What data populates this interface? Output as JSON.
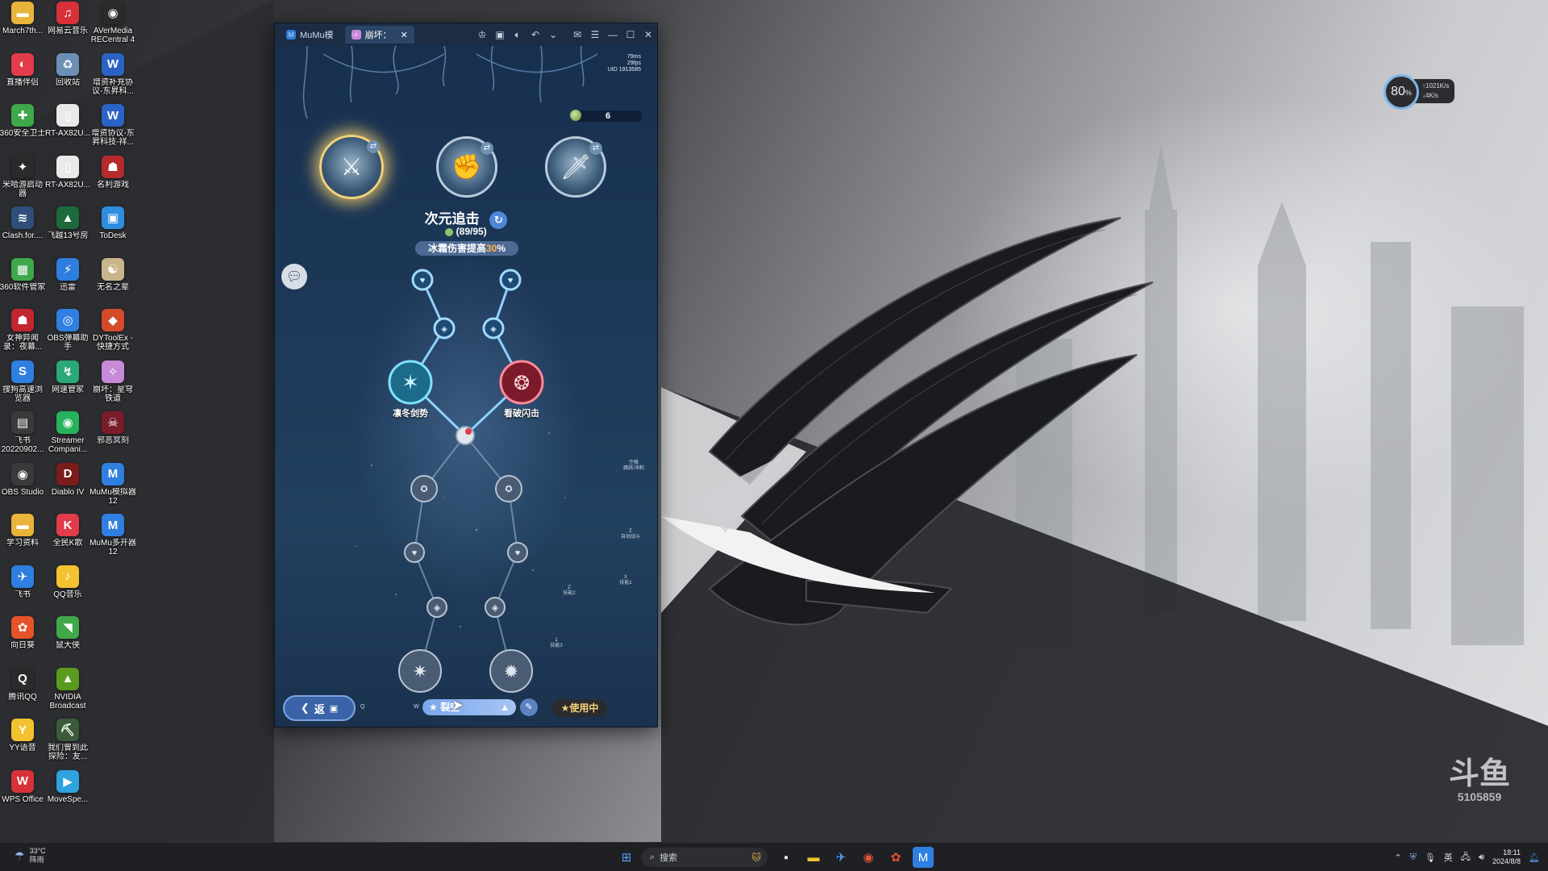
{
  "desktop": {
    "icons": [
      {
        "label": "March7th...",
        "color": "#e8b43a",
        "glyph": "▬"
      },
      {
        "label": "网易云音乐",
        "color": "#d8313a",
        "glyph": "♫"
      },
      {
        "label": "AVerMedia RECentral 4",
        "color": "#2a2a2a",
        "glyph": "◉"
      },
      {
        "label": "直播伴侣",
        "color": "#e23b4a",
        "glyph": "◐"
      },
      {
        "label": "回收站",
        "color": "#6c8fb5",
        "glyph": "♻"
      },
      {
        "label": "增资补充协议-东昇科...",
        "color": "#2b62c5",
        "glyph": "W"
      },
      {
        "label": "360安全卫士",
        "color": "#3fa84a",
        "glyph": "✚"
      },
      {
        "label": "RT-AX82U...",
        "color": "#e9e9e9",
        "glyph": "▯"
      },
      {
        "label": "增资协议-东昇科技-祥...",
        "color": "#2b62c5",
        "glyph": "W"
      },
      {
        "label": "米哈游启动器",
        "color": "#2a2a2a",
        "glyph": "✦"
      },
      {
        "label": "RT-AX82U...",
        "color": "#e9e9e9",
        "glyph": "▯"
      },
      {
        "label": "名利游戏",
        "color": "#b52b2b",
        "glyph": "☗"
      },
      {
        "label": "Clash.for....",
        "color": "#2f4f7a",
        "glyph": "≋"
      },
      {
        "label": "飞越13号房",
        "color": "#1d6a3a",
        "glyph": "▲"
      },
      {
        "label": "ToDesk",
        "color": "#2f8de0",
        "glyph": "▣"
      },
      {
        "label": "360软件管家",
        "color": "#3fa84a",
        "glyph": "▦"
      },
      {
        "label": "迅雷",
        "color": "#2e7ee0",
        "glyph": "⚡"
      },
      {
        "label": "无名之辈",
        "color": "#c9b58a",
        "glyph": "☯"
      },
      {
        "label": "女神异闻录：夜幕...",
        "color": "#c2262f",
        "glyph": "☗"
      },
      {
        "label": "OBS弹幕助手",
        "color": "#2f7fe0",
        "glyph": "◎"
      },
      {
        "label": "DYToolEx - 快捷方式",
        "color": "#d44b2a",
        "glyph": "◆"
      },
      {
        "label": "搜狗高速浏览器",
        "color": "#2f7fe0",
        "glyph": "S"
      },
      {
        "label": "网速管家",
        "color": "#2aa876",
        "glyph": "↯"
      },
      {
        "label": "崩坏：星穹铁道",
        "color": "#c88ad8",
        "glyph": "✧"
      },
      {
        "label": "飞书 20220902...",
        "color": "#3a3a3a",
        "glyph": "▤"
      },
      {
        "label": "Streamer Compani...",
        "color": "#27b35c",
        "glyph": "◉"
      },
      {
        "label": "邪恶冥刻",
        "color": "#7a1c2a",
        "glyph": "☠"
      },
      {
        "label": "OBS Studio",
        "color": "#3a3a3a",
        "glyph": "◉"
      },
      {
        "label": "Diablo IV",
        "color": "#7a1c1c",
        "glyph": "D"
      },
      {
        "label": "MuMu模拟器12",
        "color": "#2f7fe0",
        "glyph": "M"
      },
      {
        "label": "学习资料",
        "color": "#e8b43a",
        "glyph": "▬"
      },
      {
        "label": "全民K歌",
        "color": "#e23b4a",
        "glyph": "K"
      },
      {
        "label": "MuMu多开器12",
        "color": "#2f7fe0",
        "glyph": "M"
      },
      {
        "label": "飞书",
        "color": "#2f7fe0",
        "glyph": "✈"
      },
      {
        "label": "QQ音乐",
        "color": "#f2c230",
        "glyph": "♪"
      },
      {
        "label": "",
        "color": "",
        "glyph": ""
      },
      {
        "label": "向日葵",
        "color": "#e5532a",
        "glyph": "✿"
      },
      {
        "label": "鼠大侠",
        "color": "#3fa84a",
        "glyph": "◥"
      },
      {
        "label": "",
        "color": "",
        "glyph": ""
      },
      {
        "label": "腾讯QQ",
        "color": "#2a2a2a",
        "glyph": "Q"
      },
      {
        "label": "NVIDIA Broadcast",
        "color": "#5a9a1e",
        "glyph": "▲"
      },
      {
        "label": "",
        "color": "",
        "glyph": ""
      },
      {
        "label": "YY语音",
        "color": "#f2c230",
        "glyph": "Y"
      },
      {
        "label": "我们曾到此探险：友...",
        "color": "#3a5a3a",
        "glyph": "⛏"
      },
      {
        "label": "",
        "color": "",
        "glyph": ""
      },
      {
        "label": "WPS Office",
        "color": "#d8313a",
        "glyph": "W"
      },
      {
        "label": "MoveSpe...",
        "color": "#2fa3e0",
        "glyph": "▶"
      }
    ]
  },
  "emulator": {
    "tabs": [
      {
        "label": "MuMu模",
        "icon_color": "#2f7fe0"
      },
      {
        "label": "崩坏：",
        "icon_color": "#c88ad8"
      }
    ],
    "game": {
      "ping": "79ms",
      "fps": "29fps",
      "uid": "UID 1913585",
      "currency_count": "6",
      "skill_title": "次元追击",
      "points": "(89/95)",
      "buff_prefix": "冰霜伤害提高",
      "buff_value": "30",
      "buff_suffix": "%",
      "left_node_label": "凛冬剑势",
      "right_node_label": "看破闪击",
      "back_label": "返",
      "key_q": "Q",
      "key_w": "W",
      "preset_label": "裂空",
      "in_use_label": "★使用中",
      "tiny_labels": [
        {
          "text": "空格\n跳跃/冲刺"
        },
        {
          "text": "Z\n自动战斗"
        },
        {
          "text": "X\n技能1"
        },
        {
          "text": "Z\n技能2"
        },
        {
          "text": "1\n技能3"
        }
      ]
    }
  },
  "perf_widget": {
    "cpu_percent": "80",
    "upload": "1021",
    "upload_unit": "K/s",
    "download": "4",
    "download_unit": "K/s"
  },
  "watermark": {
    "main": "斗鱼",
    "sub": "5105859"
  },
  "taskbar": {
    "weather_temp": "33°C",
    "weather_desc": "阵雨",
    "search_placeholder": "搜索",
    "language": "英",
    "time": "18:11",
    "date": "2024/8/8"
  },
  "colors": {
    "accent_blue": "#7aa6ea",
    "gold": "#f2d27a",
    "buff_highlight": "#ffb347"
  }
}
